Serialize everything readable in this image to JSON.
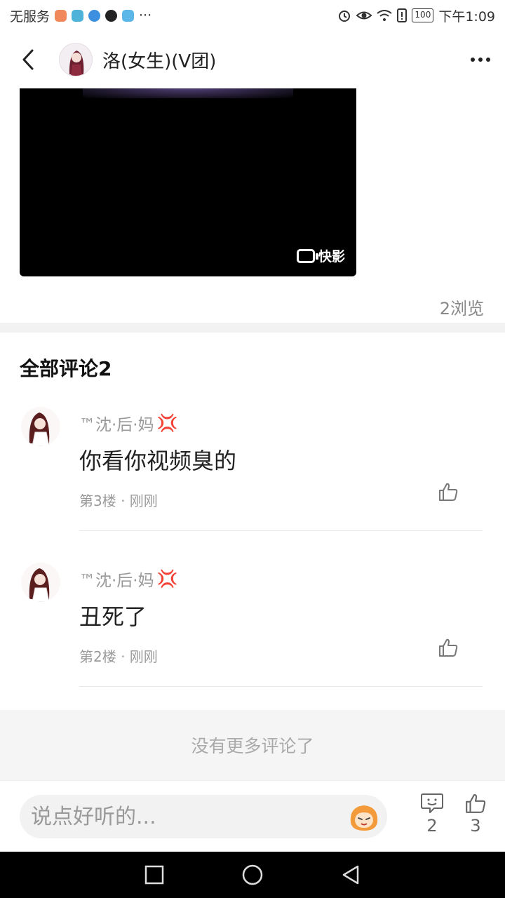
{
  "status_bar": {
    "carrier": "无服务",
    "time": "下午1:09",
    "battery": "100",
    "app_icons": [
      "app-icon-1",
      "app-icon-2",
      "app-icon-3",
      "tiktok-icon",
      "shield-app-icon"
    ],
    "more": "···"
  },
  "header": {
    "title": "洛(女生)(V团)"
  },
  "video": {
    "watermark": "快影"
  },
  "post": {
    "views": "2浏览"
  },
  "comments": {
    "title": "全部评论2",
    "items": [
      {
        "user": "™沈·后·妈",
        "text": "你看你视频臭的",
        "meta": "第3楼 · 刚刚"
      },
      {
        "user": "™沈·后·妈",
        "text": "丑死了",
        "meta": "第2楼 · 刚刚"
      }
    ],
    "no_more": "没有更多评论了"
  },
  "input_bar": {
    "placeholder": "说点好听的...",
    "comment_count": "2",
    "like_count": "3"
  },
  "colors": {
    "accent_anger": "#e07070",
    "background_gray": "#f5f5f5",
    "video_background": "#000000"
  }
}
